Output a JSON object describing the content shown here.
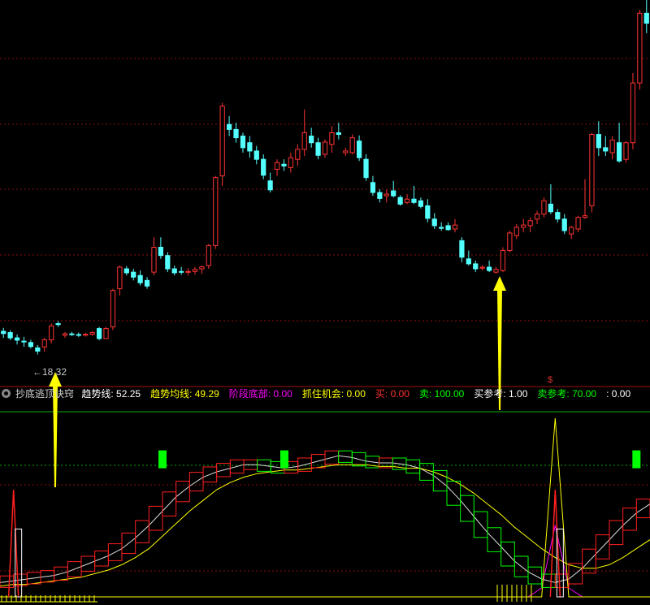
{
  "indicator_header": {
    "name": "抄底逃顶诀窍",
    "items": [
      {
        "label": "趋势线",
        "value": "52.25",
        "label_color": "#ffffff",
        "value_color": "#ffffff"
      },
      {
        "label": "趋势均线",
        "value": "49.29",
        "label_color": "#ffff00",
        "value_color": "#ffff00"
      },
      {
        "label": "阶段底部",
        "value": "0.00",
        "label_color": "#ff00ff",
        "value_color": "#ff00ff"
      },
      {
        "label": "抓住机会",
        "value": "0.00",
        "label_color": "#ffff00",
        "value_color": "#ffff00"
      },
      {
        "label": "买",
        "value": "0.00",
        "label_color": "#ff3030",
        "value_color": "#ff3030"
      },
      {
        "label": "卖",
        "value": "100.00",
        "label_color": "#00ff00",
        "value_color": "#00ff00"
      },
      {
        "label": "买参考",
        "value": "1.00",
        "label_color": "#ffffff",
        "value_color": "#ffffff"
      },
      {
        "label": "卖参考",
        "value": "70.00",
        "label_color": "#00ff00",
        "value_color": "#00ff00"
      },
      {
        "label": "",
        "value": "0.00",
        "label_color": "#ffffff",
        "value_color": "#ffffff"
      }
    ]
  },
  "low_price_label": "←18.32",
  "dollar_mark": "$",
  "colors": {
    "up": "#ff3333",
    "down": "#54ffff",
    "grid": "#8b1010",
    "arrow": "#ffff00",
    "trend_line": "#dddddd",
    "trend_avg": "#ffff00",
    "box_up": "#ff2020",
    "box_down": "#00ff00"
  },
  "chart_data": [
    {
      "type": "candlestick",
      "title": "",
      "low_annotation": "18.32",
      "ylim": [
        17.5,
        29.0
      ],
      "ohlc": [
        [
          19.02,
          19.12,
          18.82,
          18.95
        ],
        [
          18.98,
          19.05,
          18.75,
          18.82
        ],
        [
          18.82,
          18.92,
          18.62,
          18.75
        ],
        [
          18.72,
          18.85,
          18.55,
          18.7
        ],
        [
          18.68,
          18.76,
          18.5,
          18.56
        ],
        [
          18.52,
          18.6,
          18.32,
          18.42
        ],
        [
          18.55,
          18.82,
          18.4,
          18.76
        ],
        [
          18.76,
          19.25,
          18.65,
          19.18
        ],
        [
          19.25,
          19.32,
          19.15,
          19.22
        ],
        [
          18.9,
          19.0,
          18.82,
          18.94
        ],
        [
          18.94,
          19.0,
          18.88,
          18.92
        ],
        [
          18.92,
          18.98,
          18.85,
          18.9
        ],
        [
          18.9,
          18.97,
          18.86,
          18.93
        ],
        [
          18.93,
          19.02,
          18.88,
          18.98
        ],
        [
          19.1,
          19.15,
          18.75,
          18.8
        ],
        [
          18.8,
          19.15,
          18.78,
          19.1
        ],
        [
          19.15,
          20.3,
          19.05,
          20.25
        ],
        [
          20.3,
          21.0,
          20.1,
          20.95
        ],
        [
          20.9,
          20.98,
          20.7,
          20.78
        ],
        [
          20.8,
          20.9,
          20.55,
          20.65
        ],
        [
          20.7,
          20.85,
          20.4,
          20.48
        ],
        [
          20.55,
          20.65,
          20.3,
          20.38
        ],
        [
          20.8,
          21.85,
          20.7,
          21.55
        ],
        [
          21.55,
          21.85,
          21.2,
          21.3
        ],
        [
          21.3,
          21.4,
          20.8,
          20.9
        ],
        [
          20.9,
          21.0,
          20.7,
          20.78
        ],
        [
          20.82,
          20.96,
          20.72,
          20.8
        ],
        [
          20.8,
          20.92,
          20.7,
          20.82
        ],
        [
          20.82,
          20.96,
          20.72,
          20.88
        ],
        [
          20.9,
          21.0,
          20.75,
          20.96
        ],
        [
          21.0,
          21.65,
          20.9,
          21.6
        ],
        [
          21.6,
          23.7,
          21.5,
          23.65
        ],
        [
          23.7,
          25.9,
          23.4,
          25.8
        ],
        [
          25.25,
          25.5,
          24.9,
          25.1
        ],
        [
          25.1,
          25.3,
          24.7,
          24.85
        ],
        [
          24.9,
          25.0,
          24.4,
          24.55
        ],
        [
          24.7,
          24.9,
          24.25,
          24.45
        ],
        [
          24.45,
          24.6,
          24.05,
          24.2
        ],
        [
          24.2,
          24.35,
          23.6,
          23.72
        ],
        [
          23.55,
          23.8,
          23.2,
          23.28
        ],
        [
          23.9,
          24.2,
          23.7,
          24.1
        ],
        [
          24.05,
          24.2,
          23.85,
          24.0
        ],
        [
          23.95,
          24.4,
          23.8,
          24.25
        ],
        [
          24.2,
          24.65,
          24.0,
          24.5
        ],
        [
          24.5,
          25.7,
          24.3,
          25.0
        ],
        [
          24.9,
          25.15,
          24.55,
          24.7
        ],
        [
          24.7,
          24.85,
          24.2,
          24.32
        ],
        [
          24.35,
          24.8,
          24.25,
          24.72
        ],
        [
          24.65,
          25.2,
          24.4,
          25.0
        ],
        [
          25.0,
          25.3,
          24.8,
          24.95
        ],
        [
          24.4,
          24.55,
          24.3,
          24.45
        ],
        [
          24.4,
          24.95,
          24.35,
          24.85
        ],
        [
          24.75,
          24.92,
          24.15,
          24.25
        ],
        [
          24.2,
          24.35,
          23.55,
          23.65
        ],
        [
          23.5,
          23.7,
          23.1,
          23.2
        ],
        [
          23.2,
          23.3,
          22.9,
          23.02
        ],
        [
          23.1,
          23.28,
          22.9,
          23.15
        ],
        [
          23.25,
          23.55,
          23.05,
          23.1
        ],
        [
          23.05,
          23.12,
          22.8,
          22.85
        ],
        [
          22.9,
          23.15,
          22.85,
          23.0
        ],
        [
          23.0,
          23.4,
          22.85,
          22.9
        ],
        [
          22.95,
          23.05,
          22.72,
          22.78
        ],
        [
          22.8,
          23.0,
          22.3,
          22.42
        ],
        [
          22.4,
          22.58,
          22.1,
          22.2
        ],
        [
          22.15,
          22.3,
          22.05,
          22.12
        ],
        [
          22.2,
          22.3,
          22.05,
          22.08
        ],
        [
          22.1,
          22.4,
          22.0,
          22.22
        ],
        [
          21.75,
          21.85,
          21.1,
          21.25
        ],
        [
          21.2,
          21.45,
          21.0,
          21.05
        ],
        [
          21.05,
          21.15,
          20.8,
          20.9
        ],
        [
          20.92,
          21.0,
          20.85,
          20.95
        ],
        [
          20.95,
          21.15,
          20.8,
          20.85
        ],
        [
          20.8,
          20.95,
          20.75,
          20.88
        ],
        [
          20.85,
          21.55,
          20.8,
          21.45
        ],
        [
          21.45,
          22.05,
          21.4,
          21.98
        ],
        [
          21.9,
          22.25,
          21.8,
          22.15
        ],
        [
          22.15,
          22.4,
          22.0,
          22.22
        ],
        [
          22.2,
          22.45,
          22.0,
          22.35
        ],
        [
          22.4,
          22.65,
          22.25,
          22.55
        ],
        [
          22.55,
          23.05,
          22.45,
          22.95
        ],
        [
          22.85,
          23.45,
          22.55,
          22.62
        ],
        [
          22.6,
          22.7,
          22.3,
          22.4
        ],
        [
          22.4,
          22.55,
          21.95,
          22.05
        ],
        [
          21.95,
          22.2,
          21.8,
          22.15
        ],
        [
          22.1,
          22.5,
          22.0,
          22.45
        ],
        [
          22.45,
          23.6,
          22.4,
          22.5
        ],
        [
          22.8,
          25.0,
          22.6,
          24.95
        ],
        [
          24.95,
          25.35,
          24.3,
          24.55
        ],
        [
          24.55,
          24.9,
          24.3,
          24.45
        ],
        [
          24.4,
          24.9,
          24.2,
          24.78
        ],
        [
          24.7,
          25.3,
          24.1,
          24.15
        ],
        [
          24.2,
          24.75,
          24.1,
          24.7
        ],
        [
          24.7,
          26.8,
          24.5,
          26.5
        ],
        [
          26.5,
          28.7,
          26.3,
          28.6
        ],
        [
          28.6,
          29.0,
          28.0,
          28.3
        ]
      ]
    },
    {
      "type": "line",
      "title": "抄底逃顶诀窍",
      "ylim": [
        0,
        100
      ],
      "series": [
        {
          "name": "趋势线",
          "values": [
            8,
            9,
            10,
            11,
            12,
            14,
            17,
            20,
            23,
            27,
            33,
            40,
            48,
            56,
            62,
            67,
            70,
            72,
            74,
            74,
            73,
            72,
            73,
            75,
            77,
            79,
            78,
            76,
            75,
            75,
            74,
            72,
            68,
            62,
            54,
            45,
            36,
            28,
            20,
            14,
            10,
            8,
            10,
            16,
            24,
            32,
            40,
            47,
            52
          ]
        },
        {
          "name": "趋势均线",
          "values": [
            6,
            7,
            7,
            8,
            9,
            10,
            11,
            13,
            15,
            18,
            22,
            27,
            34,
            41,
            48,
            54,
            60,
            64,
            67,
            69,
            70,
            71,
            71,
            72,
            73,
            74,
            74,
            74,
            73,
            73,
            72,
            72,
            70,
            67,
            63,
            58,
            52,
            46,
            39,
            33,
            27,
            22,
            18,
            16,
            16,
            18,
            22,
            27,
            32
          ]
        },
        {
          "name": "阶段底部",
          "values": [
            0,
            0,
            0,
            0,
            0,
            0,
            0,
            0,
            0,
            0,
            0,
            0,
            0,
            0,
            0,
            0,
            0,
            0,
            0,
            0,
            0,
            0,
            0,
            0,
            0,
            0,
            0,
            0,
            0,
            0,
            0,
            0,
            0,
            0,
            0,
            0,
            0,
            0,
            0,
            0,
            5,
            40,
            5,
            0,
            0,
            0,
            0,
            0,
            0
          ]
        },
        {
          "name": "抓住机会",
          "values": [
            0,
            0,
            0,
            0,
            0,
            0,
            0,
            0,
            0,
            0,
            0,
            0,
            0,
            0,
            0,
            0,
            0,
            0,
            0,
            0,
            0,
            0,
            0,
            0,
            0,
            0,
            0,
            0,
            0,
            0,
            0,
            0,
            0,
            0,
            0,
            0,
            0,
            0,
            0,
            0,
            0,
            100,
            0,
            0,
            0,
            0,
            0,
            0,
            0
          ]
        }
      ],
      "buy_signal_index": [
        1,
        41
      ],
      "sell_signal_positions": [
        12,
        21,
        47
      ]
    }
  ]
}
